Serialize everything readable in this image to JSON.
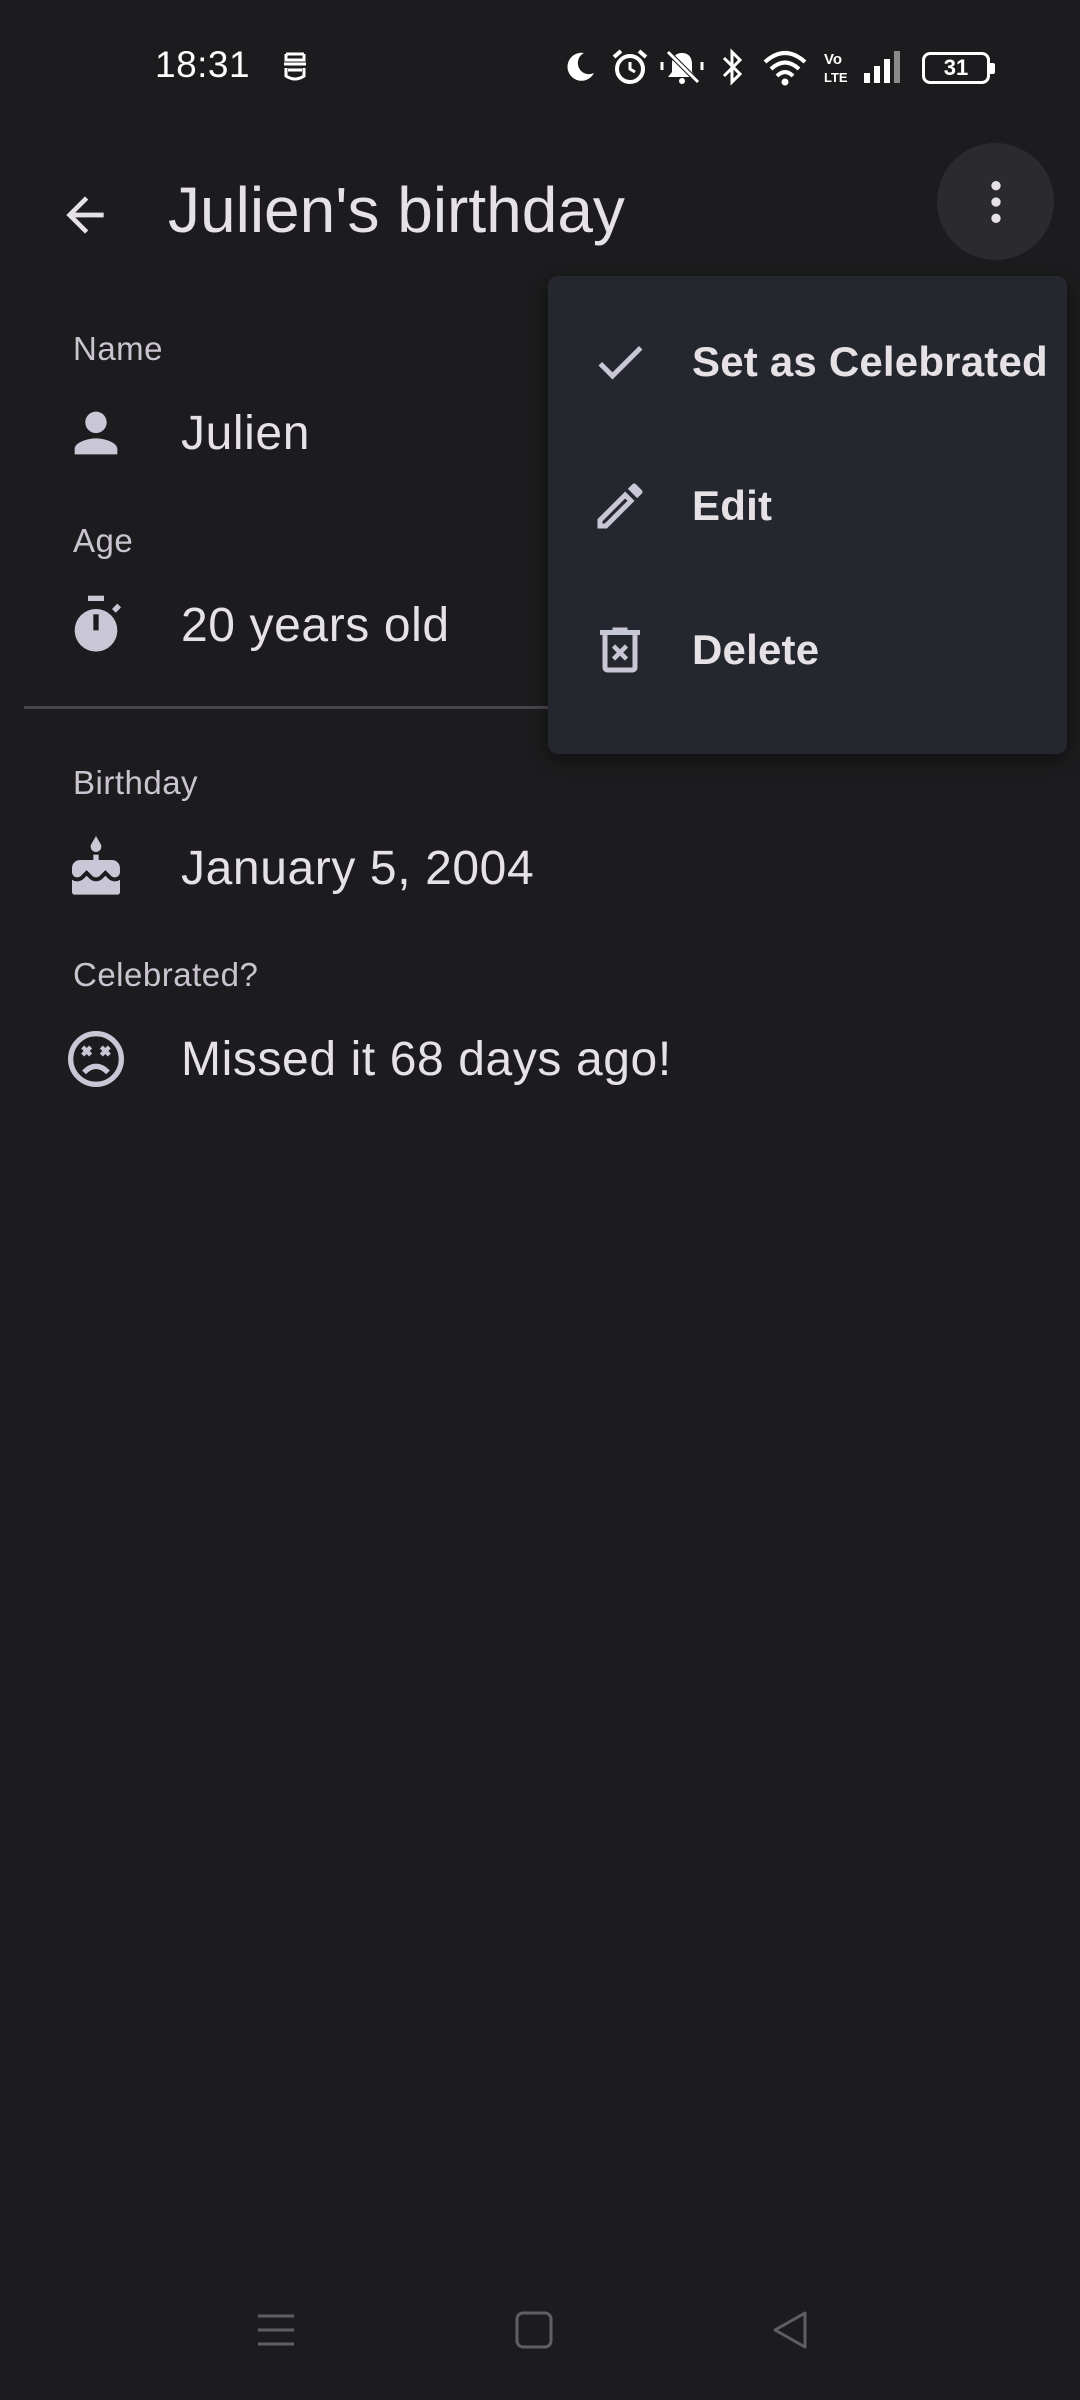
{
  "status_bar": {
    "time": "18:31",
    "battery_level": "31",
    "icons": [
      "sim-status-icon",
      "moon-icon",
      "alarm-icon",
      "bell-off-icon",
      "bluetooth-icon",
      "wifi-icon",
      "volte-icon",
      "signal-icon",
      "battery-icon"
    ]
  },
  "app_bar": {
    "title": "Julien's birthday",
    "back_icon": "arrow-back-icon",
    "more_icon": "more-vert-icon"
  },
  "details": {
    "name": {
      "label": "Name",
      "value": "Julien",
      "icon": "person-icon"
    },
    "age": {
      "label": "Age",
      "value": "20 years old",
      "icon": "timer-icon"
    },
    "birthday": {
      "label": "Birthday",
      "value": "January 5, 2004",
      "icon": "cake-icon"
    },
    "celebrated": {
      "label": "Celebrated?",
      "value": "Missed it 68 days ago!",
      "icon": "sad-face-icon"
    }
  },
  "menu": {
    "items": [
      {
        "label": "Set as Celebrated",
        "icon": "check-icon"
      },
      {
        "label": "Edit",
        "icon": "pencil-icon"
      },
      {
        "label": "Delete",
        "icon": "trash-icon"
      }
    ]
  },
  "nav_bar": {
    "icons": [
      "menu-lines-icon",
      "home-square-icon",
      "back-triangle-icon"
    ]
  },
  "colors": {
    "background": "#1c1c1e",
    "menu_background": "#25272f",
    "text_primary": "#e6e1e5",
    "text_secondary": "#cac4d0",
    "icon": "#c9c6d6"
  }
}
